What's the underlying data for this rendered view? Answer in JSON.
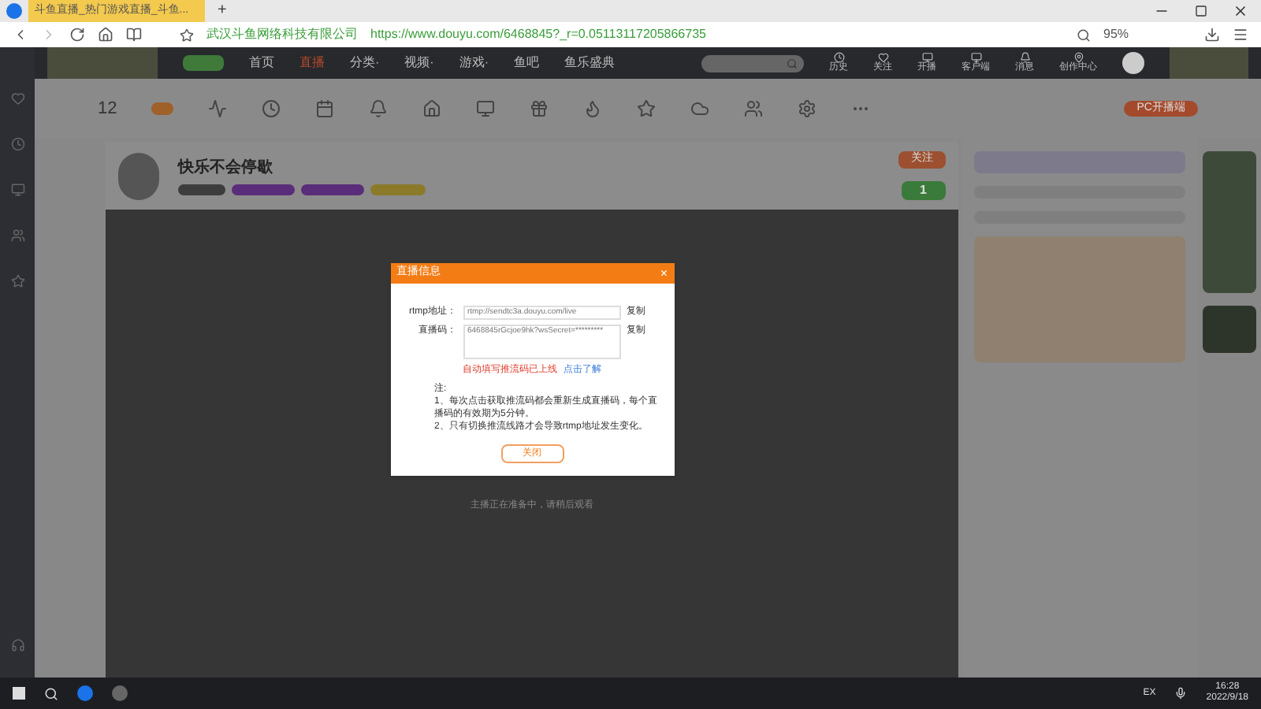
{
  "browser": {
    "tab_title": "斗鱼直播_热门游戏直播_斗鱼...",
    "site_owner": "武汉斗鱼网络科技有限公司",
    "url": "https://www.douyu.com/6468845?_r=0.05113117205866735",
    "zoom": "95%",
    "new_tab": "+"
  },
  "nav": {
    "items": [
      {
        "label": "首页",
        "selected": false
      },
      {
        "label": "直播",
        "selected": true
      },
      {
        "label": "分类·",
        "selected": false
      },
      {
        "label": "视频·",
        "selected": false
      },
      {
        "label": "游戏·",
        "selected": false
      },
      {
        "label": "鱼吧",
        "selected": false
      },
      {
        "label": "鱼乐盛典",
        "selected": false
      }
    ],
    "user_items": [
      "历史",
      "关注",
      "开播",
      "客户端",
      "消息",
      "创作中心"
    ]
  },
  "toolbar": {
    "score": "12",
    "pc_button": "PC开播端"
  },
  "streamer": {
    "name": "快乐不会停歇",
    "follow": "关注",
    "green_count": "1"
  },
  "dialog": {
    "title": "直播信息",
    "close": "×",
    "fields": [
      {
        "label": "rtmp地址：",
        "value": "rtmp://sendtc3a.douyu.com/live",
        "copy": "复制"
      },
      {
        "label": "直播码：",
        "value": "6468845rGcjoe9hk?wsSecret=*********",
        "copy": "复制"
      }
    ],
    "warning": "自动填写推流码已上线",
    "link": "点击了解",
    "notes": [
      "注:",
      "1、每次点击获取推流码都会重新生成直播码，每个直播码的有效期为5分钟。",
      "2、只有切换推流线路才会导致rtmp地址发生变化。"
    ],
    "button": "关闭"
  },
  "video_message": "主播正在准备中，请稍后观看",
  "taskbar": {
    "ime": "EX",
    "time": "16:28",
    "date": "2022/9/18"
  }
}
